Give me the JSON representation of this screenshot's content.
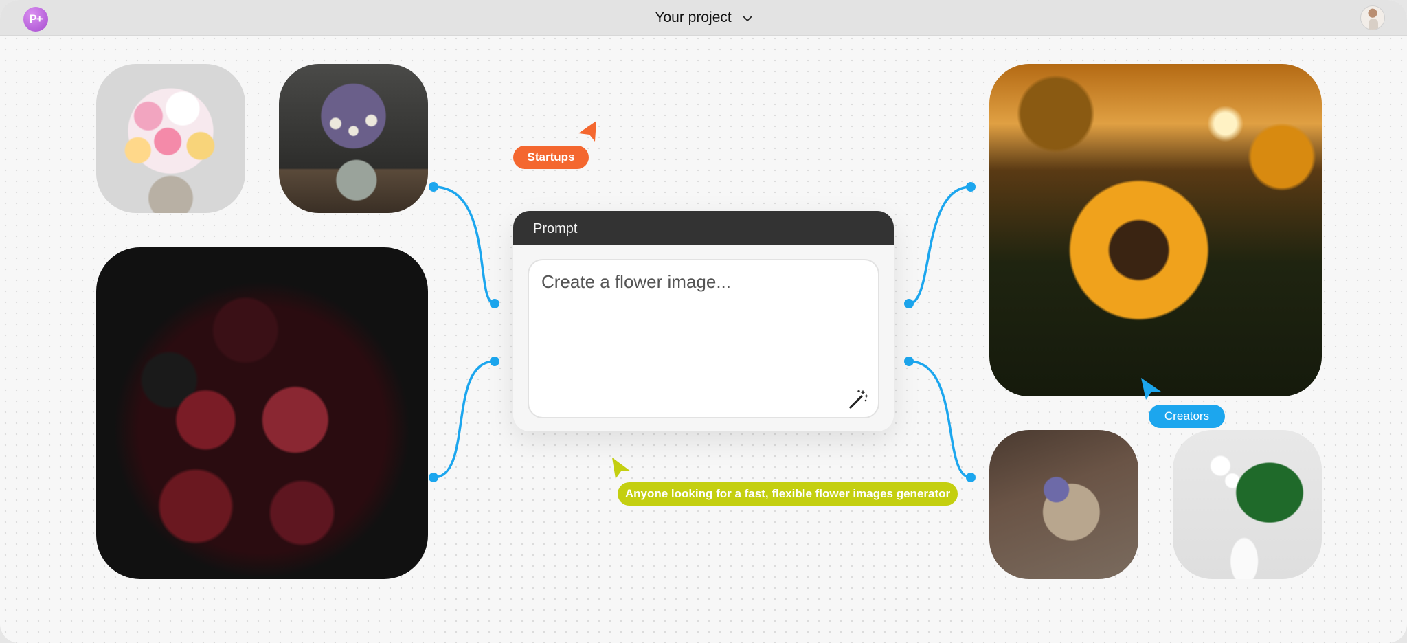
{
  "header": {
    "logo_text": "P+",
    "project_label": "Your project"
  },
  "prompt": {
    "title": "Prompt",
    "placeholder": "Create a flower image..."
  },
  "tags": {
    "startups": "Startups",
    "creators": "Creators",
    "anyone": "Anyone looking for a fast, flexible flower images generator"
  },
  "colors": {
    "connector": "#1ca6ee",
    "startups": "#f4672f",
    "creators": "#1ca6ee",
    "anyone": "#c4cf10",
    "prompt_header": "#333333"
  },
  "icons": {
    "wand": "magic-wand-icon",
    "chevron": "chevron-down-icon"
  }
}
